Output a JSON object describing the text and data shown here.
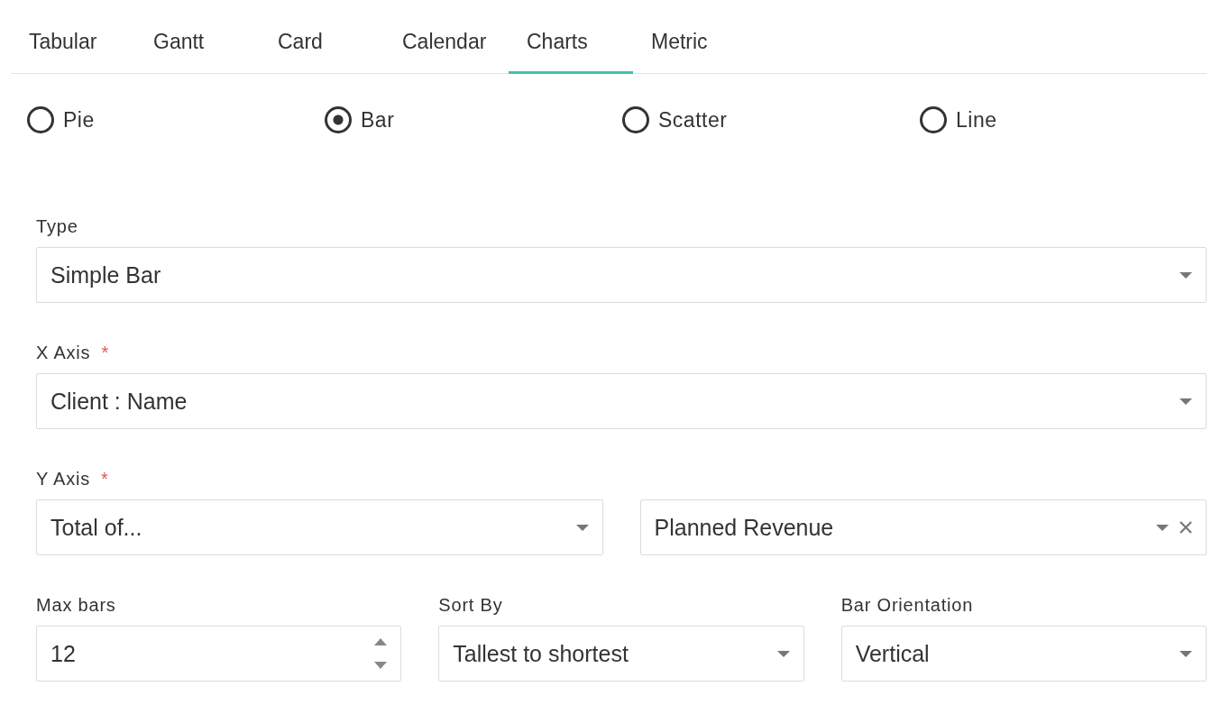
{
  "tabs": [
    {
      "label": "Tabular",
      "selected": false
    },
    {
      "label": "Gantt",
      "selected": false
    },
    {
      "label": "Card",
      "selected": false
    },
    {
      "label": "Calendar",
      "selected": false
    },
    {
      "label": "Charts",
      "selected": true
    },
    {
      "label": "Metric",
      "selected": false
    }
  ],
  "chart_types": [
    {
      "label": "Pie",
      "selected": false
    },
    {
      "label": "Bar",
      "selected": true
    },
    {
      "label": "Scatter",
      "selected": false
    },
    {
      "label": "Line",
      "selected": false
    }
  ],
  "rows": [
    {
      "fields": [
        {
          "label": "Type",
          "kind": "select",
          "value": "Simple Bar"
        }
      ]
    },
    {
      "fields": [
        {
          "label": "X Axis",
          "required_mark": "*",
          "kind": "select",
          "value": "Client : Name"
        }
      ]
    },
    {
      "label": "Y Axis",
      "required_mark": "*",
      "fields": [
        {
          "kind": "select",
          "value": "Total of..."
        },
        {
          "kind": "clearable",
          "value": "Planned Revenue"
        }
      ]
    },
    {
      "fields": [
        {
          "label": "Max bars",
          "kind": "number",
          "value": "12"
        },
        {
          "label": "Sort By",
          "kind": "select",
          "value": "Tallest to shortest"
        },
        {
          "label": "Bar Orientation",
          "kind": "select",
          "value": "Vertical"
        }
      ]
    }
  ]
}
